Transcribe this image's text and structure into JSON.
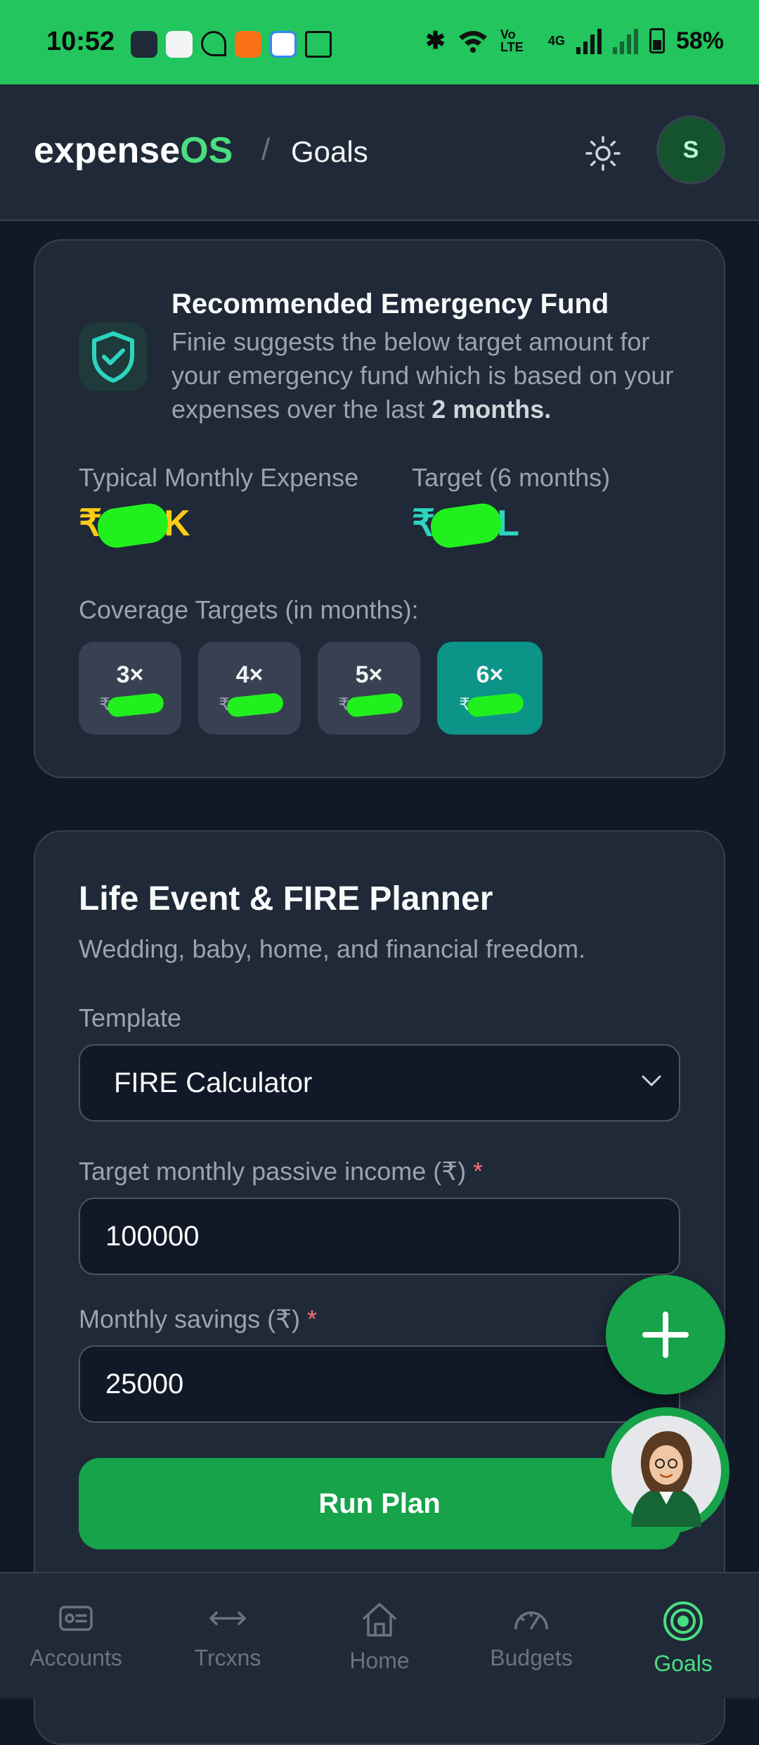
{
  "status": {
    "time": "10:52",
    "network_label": "Vo LTE",
    "gen": "4G",
    "battery": "58%"
  },
  "header": {
    "brand_part1": "expense",
    "brand_part2": "OS",
    "separator": "/",
    "page": "Goals",
    "avatar_initial": "S"
  },
  "emergency": {
    "title": "Recommended Emergency Fund",
    "desc_text": "Finie suggests the below target amount for your emergency fund which is based on your expenses over the last ",
    "desc_bold": "2 months.",
    "typical_label": "Typical Monthly Expense",
    "typical_prefix": "₹",
    "typical_suffix": "K",
    "target_label": "Target (6 months)",
    "target_prefix": "₹",
    "target_suffix": "L",
    "coverage_label": "Coverage Targets (in months):",
    "chips": [
      {
        "multiplier": "3×",
        "currency": "₹"
      },
      {
        "multiplier": "4×",
        "currency": "₹"
      },
      {
        "multiplier": "5×",
        "currency": "₹"
      },
      {
        "multiplier": "6×",
        "currency": "₹"
      }
    ],
    "selected_chip": "6×"
  },
  "planner": {
    "title": "Life Event & FIRE Planner",
    "subtitle": "Wedding, baby, home, and financial freedom.",
    "template_label": "Template",
    "template_value": "FIRE Calculator",
    "passive_label": "Target monthly passive income (₹)",
    "passive_value": "100000",
    "savings_label": "Monthly savings (₹)",
    "savings_value": "25000",
    "required_mark": "*",
    "run_button": "Run Plan"
  },
  "nav": [
    {
      "label": "Accounts",
      "icon": "accounts-icon"
    },
    {
      "label": "Trcxns",
      "icon": "transactions-icon"
    },
    {
      "label": "Home",
      "icon": "home-icon"
    },
    {
      "label": "Budgets",
      "icon": "gauge-icon"
    },
    {
      "label": "Goals",
      "icon": "target-icon"
    }
  ],
  "colors": {
    "accent": "#22c55e",
    "teal": "#0d9488",
    "yellow": "#facc15",
    "background": "#111827",
    "card": "#1f2937"
  }
}
